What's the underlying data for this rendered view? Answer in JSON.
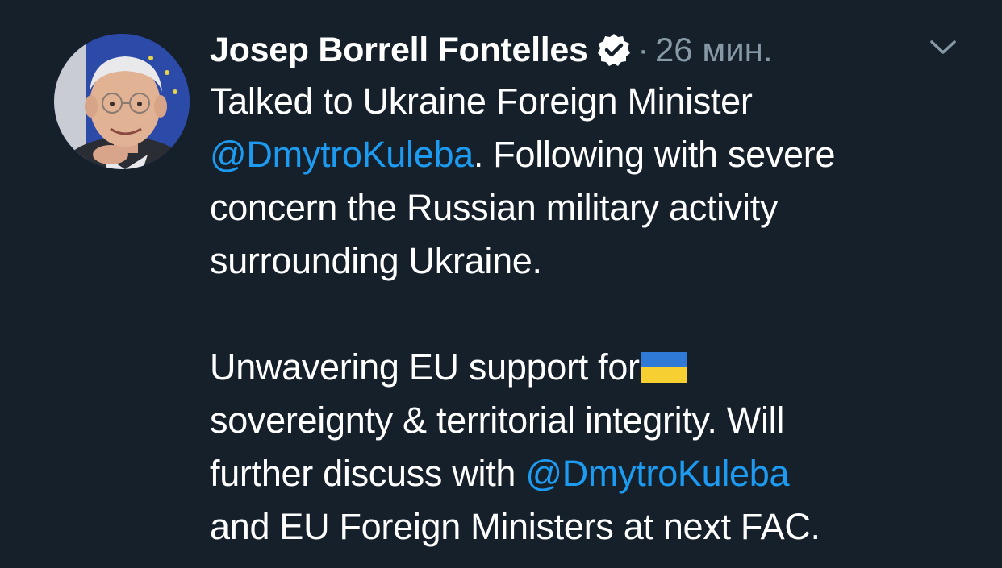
{
  "author": {
    "name": "Josep Borrell Fontelles",
    "separator": "·",
    "time": "26 мин."
  },
  "icons": {
    "verified": "verified-badge-icon",
    "menu": "chevron-down-icon",
    "flag": "ukraine-flag-emoji"
  },
  "colors": {
    "background": "#15202b",
    "text": "#ffffff",
    "muted": "#8899a6",
    "mention": "#1d9bf0"
  },
  "tweet": {
    "p1_line1": "Talked to Ukraine Foreign Minister",
    "p1_line2_mention": "@DmytroKuleba",
    "p1_line2_rest": ". Following with severe",
    "p1_line3": "concern the Russian military activity",
    "p1_line4": "surrounding Ukraine.",
    "p2_line1": "Unwavering EU support for",
    "p2_line2": "sovereignty & territorial integrity. Will",
    "p2_line3_pre": "further discuss with ",
    "p2_line3_mention": "@DmytroKuleba",
    "p2_line4": "and EU Foreign Ministers at next FAC."
  }
}
